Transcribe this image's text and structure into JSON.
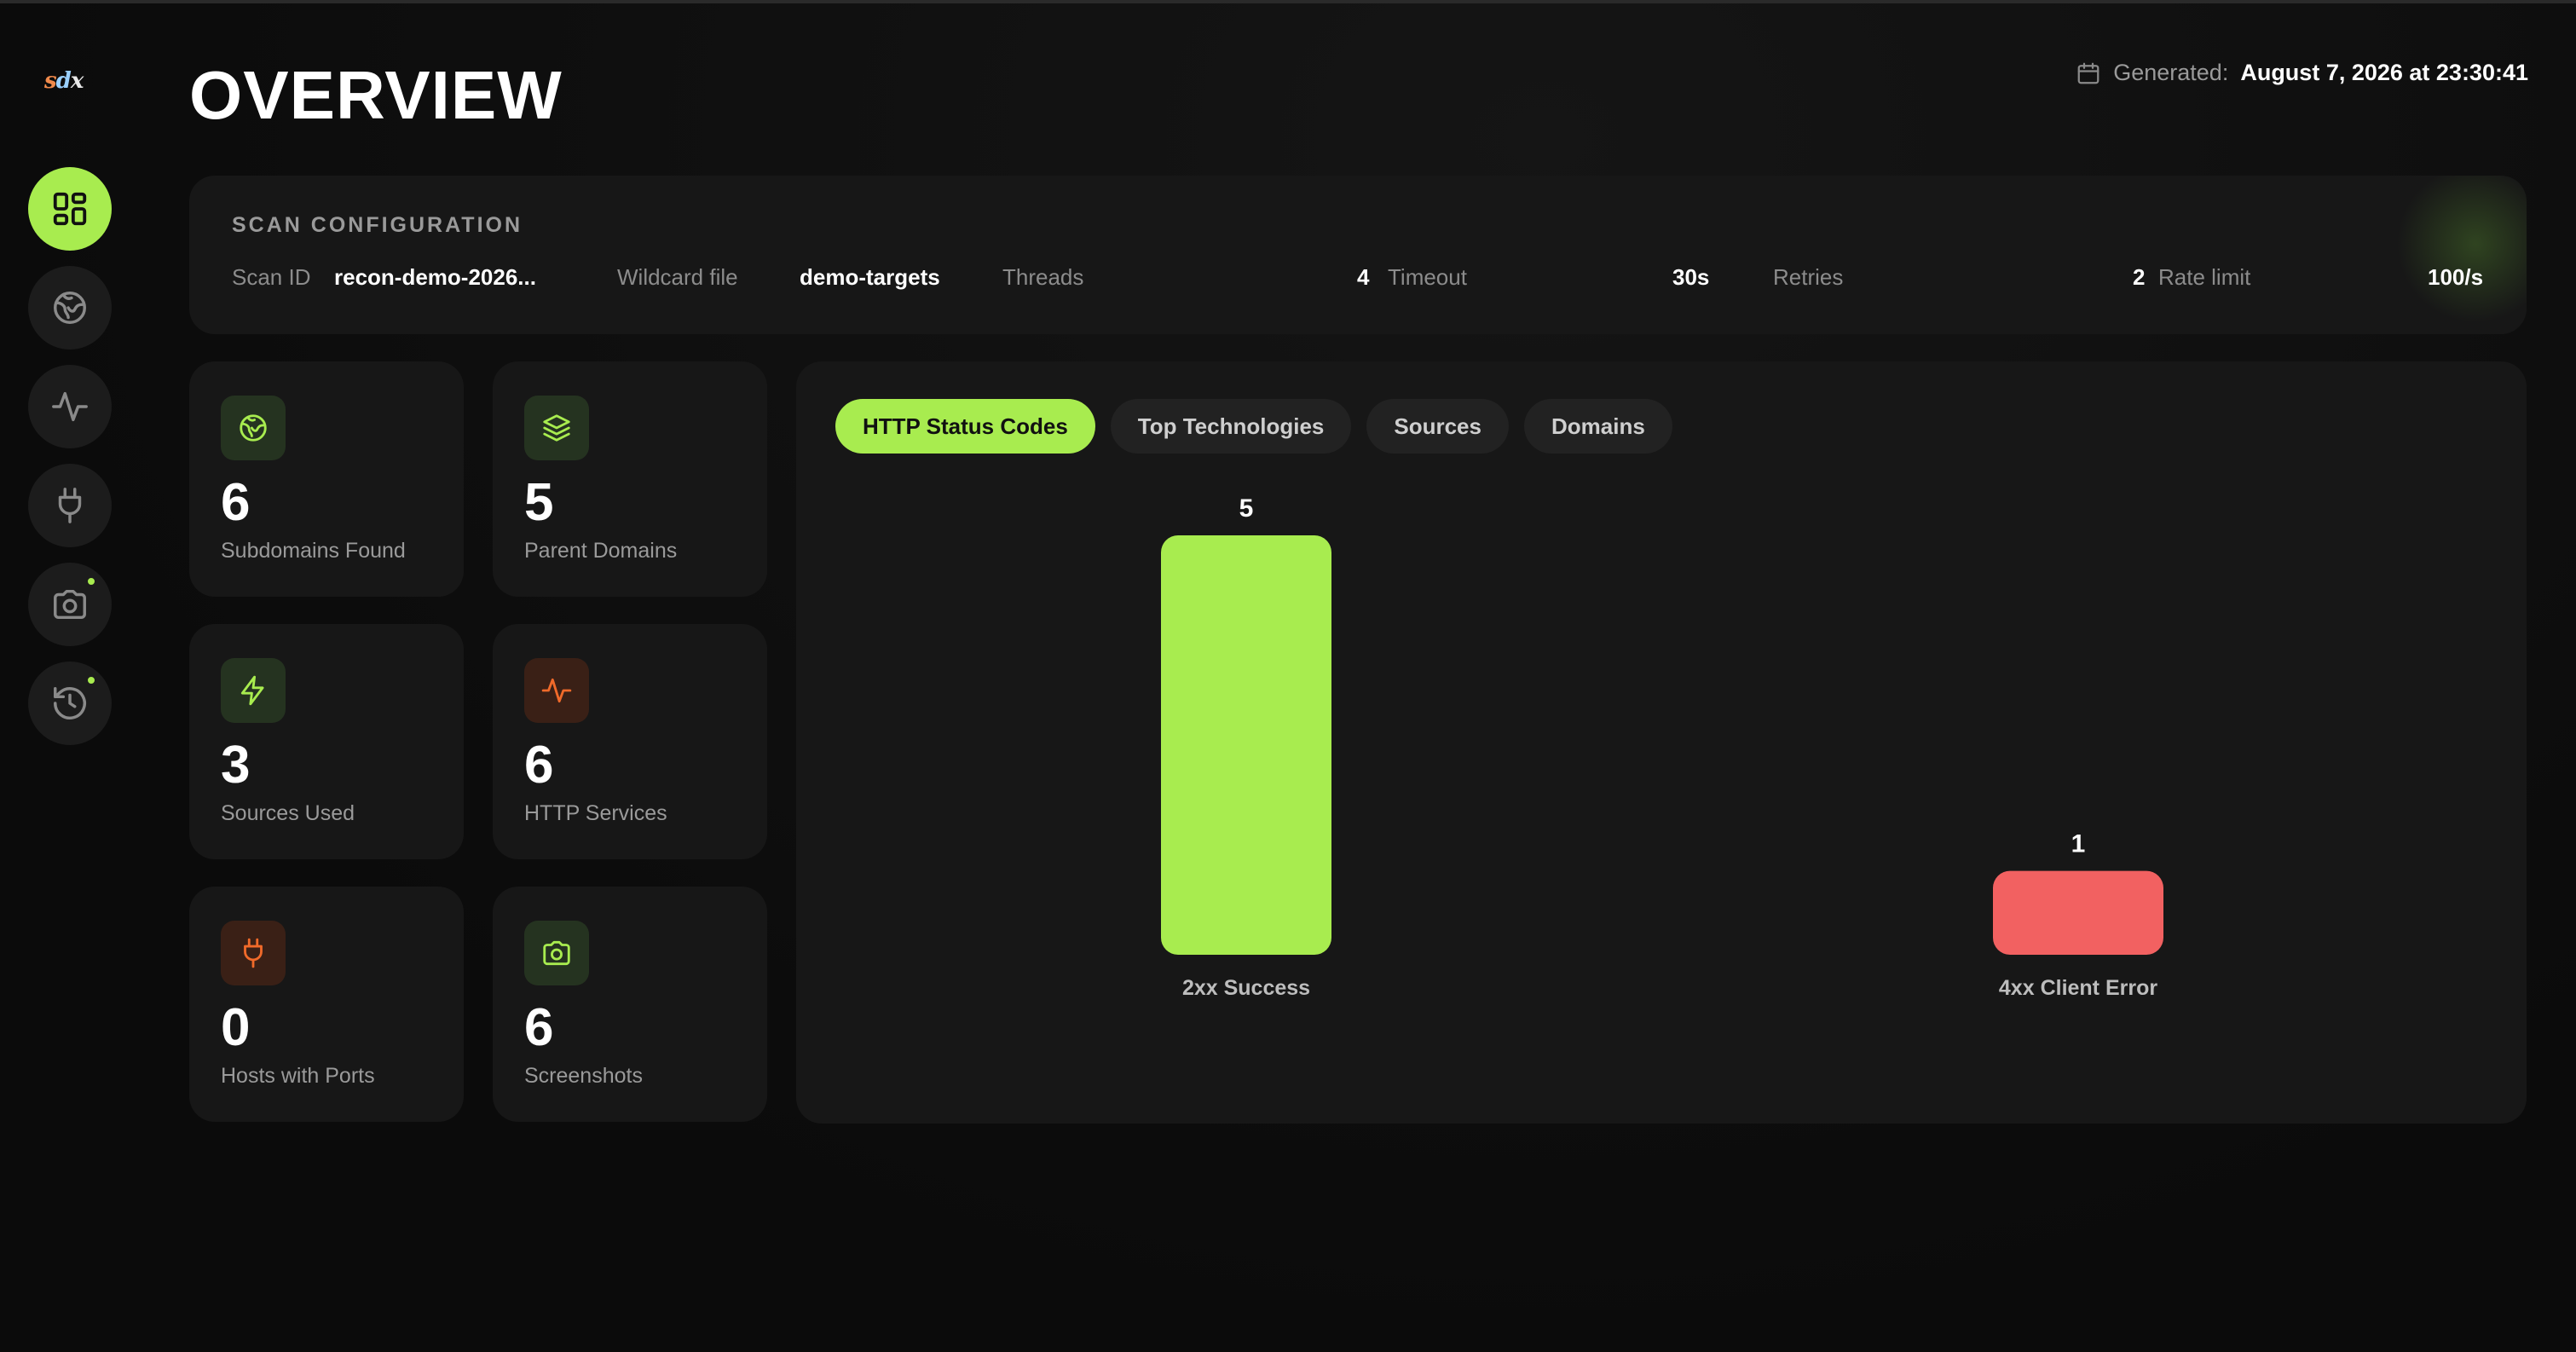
{
  "app": {
    "logo": "sdx"
  },
  "sidebar": {
    "items": [
      {
        "name": "overview",
        "icon": "dashboard-icon",
        "active": true,
        "badge": false
      },
      {
        "name": "subdomains",
        "icon": "globe-icon",
        "active": false,
        "badge": false
      },
      {
        "name": "http",
        "icon": "activity-icon",
        "active": false,
        "badge": false
      },
      {
        "name": "ports",
        "icon": "plug-icon",
        "active": false,
        "badge": false
      },
      {
        "name": "screenshots",
        "icon": "camera-icon",
        "active": false,
        "badge": true
      },
      {
        "name": "history",
        "icon": "history-icon",
        "active": false,
        "badge": true
      }
    ]
  },
  "header": {
    "title": "OVERVIEW",
    "generated_label": "Generated:",
    "generated_value": "August 7, 2026 at 23:30:41"
  },
  "scan_config": {
    "heading": "SCAN CONFIGURATION",
    "scan_id_label": "Scan ID",
    "scan_id_value": "recon-demo-2026...",
    "wildcard_label": "Wildcard file",
    "wildcard_value": "demo-targets",
    "threads_label": "Threads",
    "threads_value": "4",
    "timeout_label": "Timeout",
    "timeout_value": "30s",
    "retries_label": "Retries",
    "retries_value": "2",
    "rate_label": "Rate limit",
    "rate_value": "100/s"
  },
  "stats": [
    {
      "value": "6",
      "label": "Subdomains Found",
      "icon": "globe-icon"
    },
    {
      "value": "5",
      "label": "Parent Domains",
      "icon": "layers-icon"
    },
    {
      "value": "3",
      "label": "Sources Used",
      "icon": "bolt-icon"
    },
    {
      "value": "6",
      "label": "HTTP Services",
      "icon": "activity-icon"
    },
    {
      "value": "0",
      "label": "Hosts with Ports",
      "icon": "plug-icon"
    },
    {
      "value": "6",
      "label": "Screenshots",
      "icon": "camera-icon"
    }
  ],
  "chart_tabs": [
    {
      "label": "HTTP Status Codes",
      "active": true
    },
    {
      "label": "Top Technologies",
      "active": false
    },
    {
      "label": "Sources",
      "active": false
    },
    {
      "label": "Domains",
      "active": false
    }
  ],
  "colors": {
    "accent": "#a8ec4f",
    "error": "#f26161",
    "panel": "#171717"
  },
  "chart_data": {
    "type": "bar",
    "categories": [
      "2xx Success",
      "4xx Client Error"
    ],
    "values": [
      5,
      1
    ],
    "colors": [
      "#a8ec4f",
      "#f26161"
    ],
    "title": "",
    "xlabel": "",
    "ylabel": "",
    "ylim": [
      0,
      5
    ],
    "grid": false,
    "legend": "none"
  }
}
